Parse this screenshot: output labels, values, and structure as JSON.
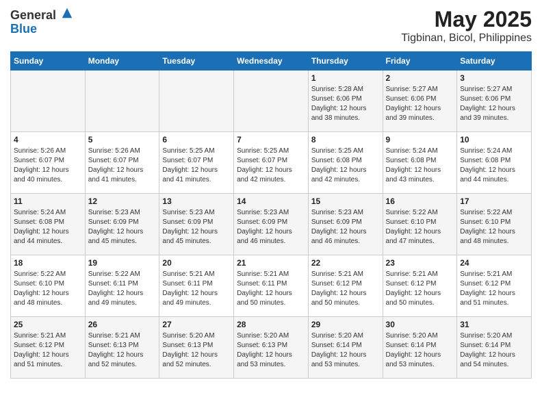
{
  "app": {
    "name_general": "General",
    "name_blue": "Blue"
  },
  "header": {
    "title": "May 2025",
    "subtitle": "Tigbinan, Bicol, Philippines"
  },
  "weekdays": [
    "Sunday",
    "Monday",
    "Tuesday",
    "Wednesday",
    "Thursday",
    "Friday",
    "Saturday"
  ],
  "weeks": [
    [
      {
        "day": "",
        "info": ""
      },
      {
        "day": "",
        "info": ""
      },
      {
        "day": "",
        "info": ""
      },
      {
        "day": "",
        "info": ""
      },
      {
        "day": "1",
        "info": "Sunrise: 5:28 AM\nSunset: 6:06 PM\nDaylight: 12 hours\nand 38 minutes."
      },
      {
        "day": "2",
        "info": "Sunrise: 5:27 AM\nSunset: 6:06 PM\nDaylight: 12 hours\nand 39 minutes."
      },
      {
        "day": "3",
        "info": "Sunrise: 5:27 AM\nSunset: 6:06 PM\nDaylight: 12 hours\nand 39 minutes."
      }
    ],
    [
      {
        "day": "4",
        "info": "Sunrise: 5:26 AM\nSunset: 6:07 PM\nDaylight: 12 hours\nand 40 minutes."
      },
      {
        "day": "5",
        "info": "Sunrise: 5:26 AM\nSunset: 6:07 PM\nDaylight: 12 hours\nand 41 minutes."
      },
      {
        "day": "6",
        "info": "Sunrise: 5:25 AM\nSunset: 6:07 PM\nDaylight: 12 hours\nand 41 minutes."
      },
      {
        "day": "7",
        "info": "Sunrise: 5:25 AM\nSunset: 6:07 PM\nDaylight: 12 hours\nand 42 minutes."
      },
      {
        "day": "8",
        "info": "Sunrise: 5:25 AM\nSunset: 6:08 PM\nDaylight: 12 hours\nand 42 minutes."
      },
      {
        "day": "9",
        "info": "Sunrise: 5:24 AM\nSunset: 6:08 PM\nDaylight: 12 hours\nand 43 minutes."
      },
      {
        "day": "10",
        "info": "Sunrise: 5:24 AM\nSunset: 6:08 PM\nDaylight: 12 hours\nand 44 minutes."
      }
    ],
    [
      {
        "day": "11",
        "info": "Sunrise: 5:24 AM\nSunset: 6:08 PM\nDaylight: 12 hours\nand 44 minutes."
      },
      {
        "day": "12",
        "info": "Sunrise: 5:23 AM\nSunset: 6:09 PM\nDaylight: 12 hours\nand 45 minutes."
      },
      {
        "day": "13",
        "info": "Sunrise: 5:23 AM\nSunset: 6:09 PM\nDaylight: 12 hours\nand 45 minutes."
      },
      {
        "day": "14",
        "info": "Sunrise: 5:23 AM\nSunset: 6:09 PM\nDaylight: 12 hours\nand 46 minutes."
      },
      {
        "day": "15",
        "info": "Sunrise: 5:23 AM\nSunset: 6:09 PM\nDaylight: 12 hours\nand 46 minutes."
      },
      {
        "day": "16",
        "info": "Sunrise: 5:22 AM\nSunset: 6:10 PM\nDaylight: 12 hours\nand 47 minutes."
      },
      {
        "day": "17",
        "info": "Sunrise: 5:22 AM\nSunset: 6:10 PM\nDaylight: 12 hours\nand 48 minutes."
      }
    ],
    [
      {
        "day": "18",
        "info": "Sunrise: 5:22 AM\nSunset: 6:10 PM\nDaylight: 12 hours\nand 48 minutes."
      },
      {
        "day": "19",
        "info": "Sunrise: 5:22 AM\nSunset: 6:11 PM\nDaylight: 12 hours\nand 49 minutes."
      },
      {
        "day": "20",
        "info": "Sunrise: 5:21 AM\nSunset: 6:11 PM\nDaylight: 12 hours\nand 49 minutes."
      },
      {
        "day": "21",
        "info": "Sunrise: 5:21 AM\nSunset: 6:11 PM\nDaylight: 12 hours\nand 50 minutes."
      },
      {
        "day": "22",
        "info": "Sunrise: 5:21 AM\nSunset: 6:12 PM\nDaylight: 12 hours\nand 50 minutes."
      },
      {
        "day": "23",
        "info": "Sunrise: 5:21 AM\nSunset: 6:12 PM\nDaylight: 12 hours\nand 50 minutes."
      },
      {
        "day": "24",
        "info": "Sunrise: 5:21 AM\nSunset: 6:12 PM\nDaylight: 12 hours\nand 51 minutes."
      }
    ],
    [
      {
        "day": "25",
        "info": "Sunrise: 5:21 AM\nSunset: 6:12 PM\nDaylight: 12 hours\nand 51 minutes."
      },
      {
        "day": "26",
        "info": "Sunrise: 5:21 AM\nSunset: 6:13 PM\nDaylight: 12 hours\nand 52 minutes."
      },
      {
        "day": "27",
        "info": "Sunrise: 5:20 AM\nSunset: 6:13 PM\nDaylight: 12 hours\nand 52 minutes."
      },
      {
        "day": "28",
        "info": "Sunrise: 5:20 AM\nSunset: 6:13 PM\nDaylight: 12 hours\nand 53 minutes."
      },
      {
        "day": "29",
        "info": "Sunrise: 5:20 AM\nSunset: 6:14 PM\nDaylight: 12 hours\nand 53 minutes."
      },
      {
        "day": "30",
        "info": "Sunrise: 5:20 AM\nSunset: 6:14 PM\nDaylight: 12 hours\nand 53 minutes."
      },
      {
        "day": "31",
        "info": "Sunrise: 5:20 AM\nSunset: 6:14 PM\nDaylight: 12 hours\nand 54 minutes."
      }
    ]
  ]
}
